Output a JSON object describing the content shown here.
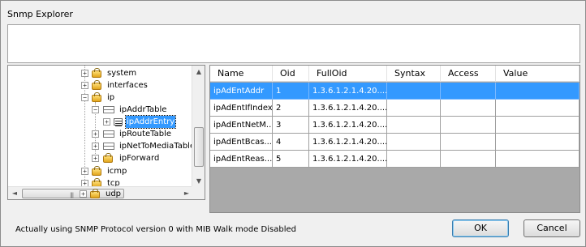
{
  "window": {
    "title": "Snmp Explorer"
  },
  "tree": {
    "nodes": [
      {
        "label": "system"
      },
      {
        "label": "interfaces"
      },
      {
        "label": "ip"
      },
      {
        "label": "ipAddrTable"
      },
      {
        "label": "ipAddrEntry"
      },
      {
        "label": "ipRouteTable"
      },
      {
        "label": "ipNetToMediaTable"
      },
      {
        "label": "ipForward"
      },
      {
        "label": "icmp"
      },
      {
        "label": "tcp"
      },
      {
        "label": "udp"
      }
    ],
    "expander_plus": "+",
    "expander_minus": "−",
    "selected": "ipAddrEntry"
  },
  "grid": {
    "columns": [
      "Name",
      "Oid",
      "FullOid",
      "Syntax",
      "Access",
      "Value"
    ],
    "rows": [
      {
        "name": "ipAdEntAddr",
        "oid": "1",
        "fulloid": "1.3.6.1.2.1.4.20....",
        "syntax": "",
        "access": "",
        "value": ""
      },
      {
        "name": "ipAdEntIfIndex",
        "oid": "2",
        "fulloid": "1.3.6.1.2.1.4.20....",
        "syntax": "",
        "access": "",
        "value": ""
      },
      {
        "name": "ipAdEntNetM...",
        "oid": "3",
        "fulloid": "1.3.6.1.2.1.4.20....",
        "syntax": "",
        "access": "",
        "value": ""
      },
      {
        "name": "ipAdEntBcas...",
        "oid": "4",
        "fulloid": "1.3.6.1.2.1.4.20....",
        "syntax": "",
        "access": "",
        "value": ""
      },
      {
        "name": "ipAdEntReas...",
        "oid": "5",
        "fulloid": "1.3.6.1.2.1.4.20....",
        "syntax": "",
        "access": "",
        "value": ""
      }
    ],
    "selected_row": 0
  },
  "status": {
    "text": "Actually using SNMP Protocol version 0 with MIB Walk mode Disabled"
  },
  "buttons": {
    "ok": "OK",
    "cancel": "Cancel"
  },
  "scroll": {
    "up": "▲",
    "down": "▼",
    "left": "◄",
    "right": "►",
    "grip": "|||"
  },
  "colors": {
    "selection": "#3399ff",
    "grid_background": "#a9a9a9"
  }
}
